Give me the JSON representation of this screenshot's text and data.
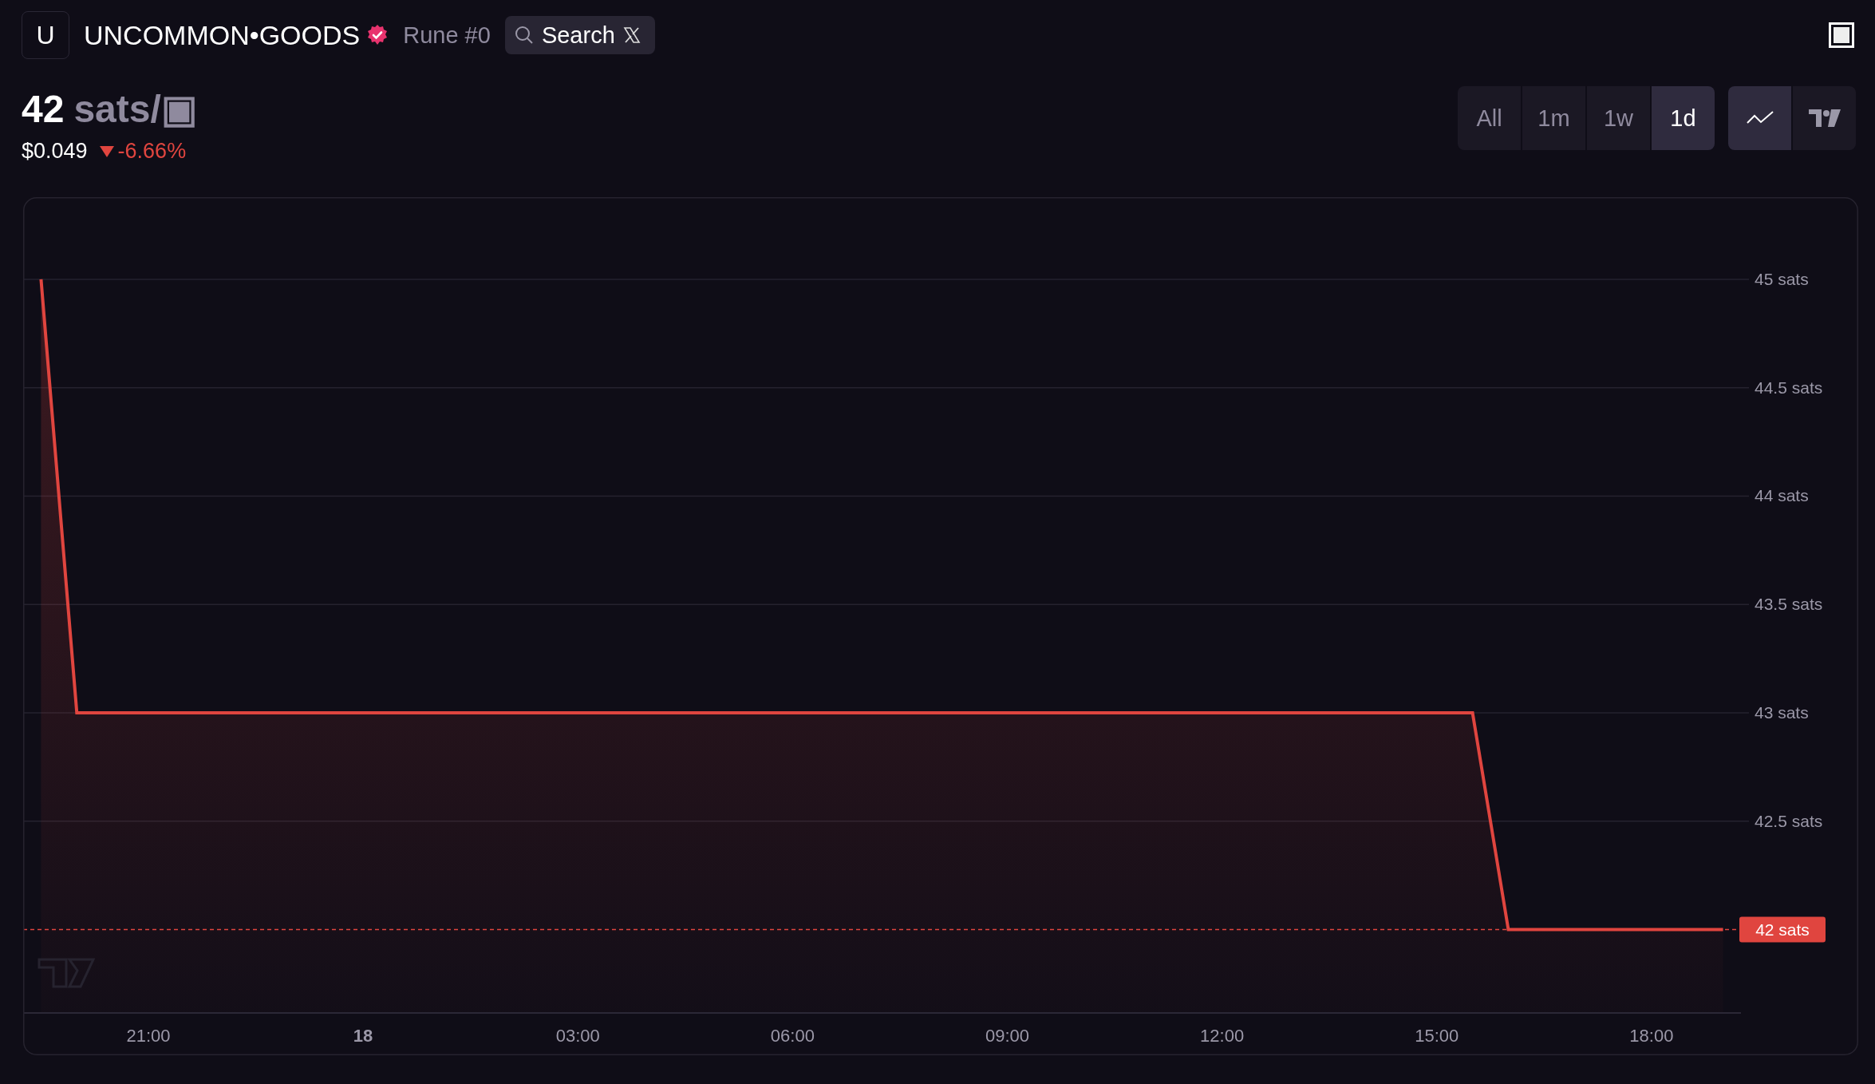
{
  "header": {
    "logo_letter": "U",
    "name": "UNCOMMON•GOODS",
    "verified": true,
    "rune_number": "Rune #0",
    "search_label": "Search"
  },
  "price": {
    "value": "42",
    "unit": "sats/▣",
    "usd": "$0.049",
    "change": "-6.66%",
    "falling": true
  },
  "timeframes": [
    {
      "label": "All",
      "selected": false
    },
    {
      "label": "1m",
      "selected": false
    },
    {
      "label": "1w",
      "selected": false
    },
    {
      "label": "1d",
      "selected": true
    }
  ],
  "chart_types": [
    {
      "kind": "line",
      "selected": true
    },
    {
      "kind": "logo",
      "selected": false
    }
  ],
  "chart": {
    "chart_data": {
      "type": "area",
      "grid": true,
      "ref_lines": [
        {
          "axis": "y",
          "value": 42,
          "label": "42 sats"
        }
      ],
      "ylim": [
        41.615,
        45.379
      ],
      "categories": [
        null,
        null,
        null,
        "21:00",
        null,
        null,
        null,
        null,
        null,
        "18",
        null,
        null,
        null,
        null,
        null,
        "03:00",
        null,
        null,
        null,
        null,
        null,
        "06:00",
        null,
        null,
        null,
        null,
        null,
        "09:00",
        null,
        null,
        null,
        null,
        null,
        "12:00",
        null,
        null,
        null,
        null,
        null,
        "15:00",
        null,
        null,
        null,
        null,
        null,
        "18:00",
        null,
        null
      ],
      "series": [
        {
          "color": "#e0453f",
          "values": [
            45,
            43,
            43,
            43,
            43,
            43,
            43,
            43,
            43,
            43,
            43,
            43,
            43,
            43,
            43,
            43,
            43,
            43,
            43,
            43,
            43,
            43,
            43,
            43,
            43,
            43,
            43,
            43,
            43,
            43,
            43,
            43,
            43,
            43,
            43,
            43,
            43,
            43,
            43,
            43,
            43,
            42,
            42,
            42,
            42,
            42,
            42,
            42
          ]
        }
      ],
      "yticks": [
        {
          "value": 42.5,
          "label": "42.5 sats"
        },
        {
          "value": 43,
          "label": "43 sats"
        },
        {
          "value": 43.5,
          "label": "43.5 sats"
        },
        {
          "value": 44,
          "label": "44 sats"
        },
        {
          "value": 44.5,
          "label": "44.5 sats"
        },
        {
          "value": 45,
          "label": "45 sats"
        }
      ]
    }
  }
}
